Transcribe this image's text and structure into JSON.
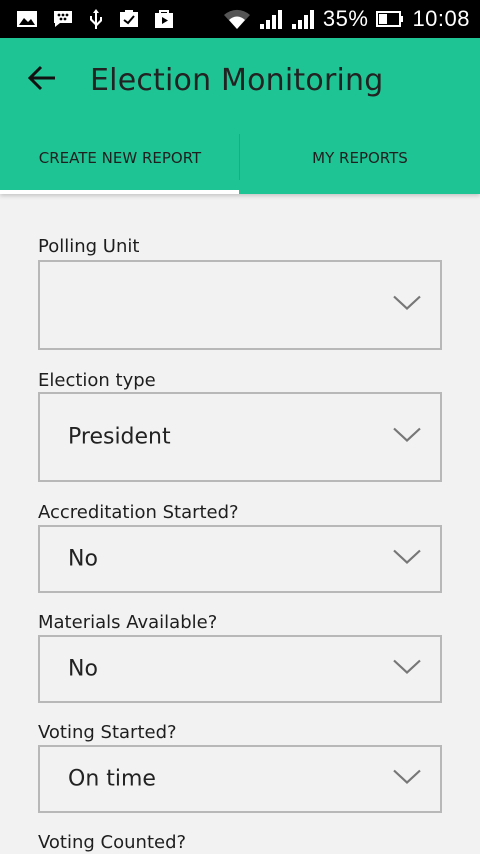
{
  "status_bar": {
    "battery_percent": "35%",
    "time": "10:08",
    "icons": [
      "gallery-icon",
      "bbm-icon",
      "usb-icon",
      "task-icon",
      "play-store-icon",
      "wifi-icon",
      "signal-icon",
      "signal-icon-2",
      "battery-icon"
    ]
  },
  "app_bar": {
    "title": "Election Monitoring",
    "back_icon": "arrow-left-icon",
    "color": "#1fc494"
  },
  "tabs": [
    {
      "label": "CREATE NEW REPORT",
      "selected": true
    },
    {
      "label": "MY REPORTS",
      "selected": false
    }
  ],
  "form": {
    "fields": [
      {
        "label": "Polling Unit",
        "value": ""
      },
      {
        "label": "Election type",
        "value": "President"
      },
      {
        "label": "Accreditation Started?",
        "value": "No"
      },
      {
        "label": "Materials Available?",
        "value": "No"
      },
      {
        "label": "Voting Started?",
        "value": "On time"
      },
      {
        "label": "Voting Counted?",
        "value": ""
      }
    ]
  }
}
